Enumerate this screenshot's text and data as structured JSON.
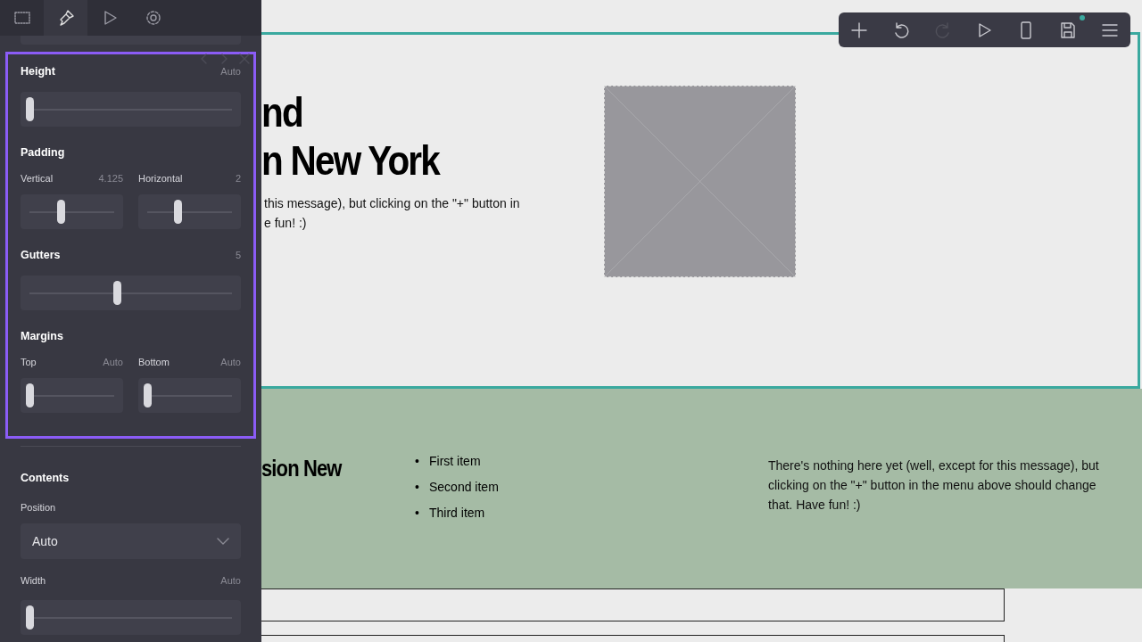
{
  "sidebar": {
    "tabs": [
      {
        "kind": "select",
        "selected": false
      },
      {
        "kind": "style",
        "selected": true
      },
      {
        "kind": "preview",
        "selected": false
      },
      {
        "kind": "settings",
        "selected": false
      }
    ],
    "highlighted_group": {
      "sections": [
        {
          "title": "Height",
          "reading": "Auto",
          "sliders": [
            {
              "level": 0
            }
          ]
        },
        {
          "title": "Padding",
          "sliders": [
            {
              "label": "Vertical",
              "reading": "4.125",
              "level": 0.37
            },
            {
              "label": "Horizontal",
              "reading": "2",
              "level": 0.36
            }
          ]
        },
        {
          "title": "Gutters",
          "reading": "5",
          "sliders": [
            {
              "level": 0.43
            }
          ]
        },
        {
          "title": "Margins",
          "sliders": [
            {
              "label": "Top",
              "reading": "Auto",
              "level": 0
            },
            {
              "label": "Bottom",
              "reading": "Auto",
              "level": 0
            }
          ]
        }
      ]
    },
    "contents": {
      "title": "Contents",
      "position": {
        "label": "Position",
        "value": "Auto"
      },
      "width": {
        "label": "Width",
        "reading": "Auto",
        "level": 0
      }
    }
  },
  "toolbar": [
    {
      "kind": "add",
      "disabled": false
    },
    {
      "kind": "undo",
      "disabled": false
    },
    {
      "kind": "redo",
      "disabled": true
    },
    {
      "kind": "play",
      "disabled": false
    },
    {
      "kind": "device",
      "disabled": false
    },
    {
      "kind": "save",
      "disabled": false,
      "badge": true
    },
    {
      "kind": "menu",
      "disabled": false
    }
  ],
  "hero": {
    "heading_lines": [
      "nd",
      "n New York"
    ],
    "text_lines": [
      "this message), but clicking on the \"+\" button in",
      "e fun! :)"
    ],
    "image": {
      "kind": "placeholder"
    }
  },
  "feature": {
    "heading": "sion New",
    "marker": "•",
    "list": [
      "First item",
      "Second item",
      "Third item"
    ],
    "text": "There's nothing here yet (well, except for this message), but clicking on the \"+\" button in the menu above should change that. Have fun! :)"
  },
  "blocks": [
    {
      "kind": "empty"
    },
    {
      "kind": "empty"
    }
  ]
}
